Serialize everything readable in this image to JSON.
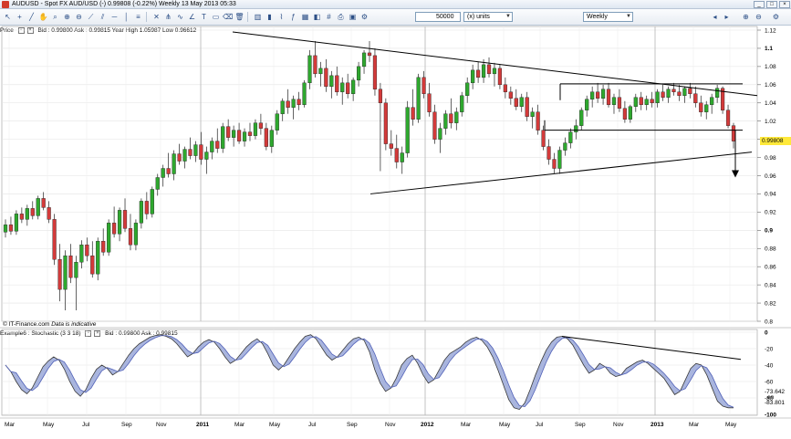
{
  "window": {
    "title": "AUDUSD - Spot FX AUD/USD (-)  0.99808 (-0.22%)   Weekly  13 May 2013 05:33"
  },
  "toolbar": {
    "quantity": "50000",
    "units": "(x) units",
    "period": "Weekly"
  },
  "price_panel": {
    "title": "Price",
    "info": "Bid : 0.99800 Ask : 0.99815  Year High 1.05987  Low 0.96612",
    "last_price": "0.99808",
    "footer_brand": "© IT-Finance.com",
    "footer_note": "Data is indicative"
  },
  "stoch_panel": {
    "title": "Example6 : Stochastic (3 3 18)",
    "info": "Bid : 0.99800 Ask : 0.99815",
    "value1": "-73.642",
    "value_sep": "en",
    "value2": "-83.801"
  },
  "colors": {
    "up": "#2ea82e",
    "down": "#d33a3a",
    "stoch_fill": "#9aa8d8",
    "stoch_line": "#3a3a3a"
  },
  "chart_data": {
    "type": "candlestick",
    "x_ticks": [
      "Mar",
      "May",
      "Jul",
      "Sep",
      "Nov",
      "2011",
      "Mar",
      "May",
      "Jul",
      "Sep",
      "Nov",
      "2012",
      "Mar",
      "May",
      "Jul",
      "Sep",
      "Nov",
      "2013",
      "Mar",
      "May"
    ],
    "price_y_ticks": [
      "1.12",
      "1.1",
      "1.08",
      "1.06",
      "1.04",
      "1.02",
      "1",
      "0.98",
      "0.96",
      "0.94",
      "0.92",
      "0.9",
      "0.88",
      "0.86",
      "0.84",
      "0.82",
      "0.8"
    ],
    "price_ylim": [
      0.8,
      1.12
    ],
    "stoch_y_ticks": [
      "0",
      "-20",
      "-40",
      "-60",
      "-80",
      "-100"
    ],
    "stoch_ylim": [
      -100,
      0
    ],
    "candles": [
      [
        0.898,
        0.912,
        0.892,
        0.906
      ],
      [
        0.906,
        0.915,
        0.895,
        0.899
      ],
      [
        0.899,
        0.922,
        0.895,
        0.918
      ],
      [
        0.918,
        0.925,
        0.908,
        0.912
      ],
      [
        0.912,
        0.928,
        0.905,
        0.924
      ],
      [
        0.924,
        0.932,
        0.912,
        0.916
      ],
      [
        0.916,
        0.938,
        0.912,
        0.935
      ],
      [
        0.935,
        0.942,
        0.922,
        0.925
      ],
      [
        0.925,
        0.932,
        0.908,
        0.912
      ],
      [
        0.912,
        0.918,
        0.862,
        0.868
      ],
      [
        0.868,
        0.885,
        0.822,
        0.835
      ],
      [
        0.835,
        0.878,
        0.812,
        0.872
      ],
      [
        0.872,
        0.885,
        0.842,
        0.848
      ],
      [
        0.848,
        0.872,
        0.812,
        0.865
      ],
      [
        0.865,
        0.889,
        0.858,
        0.884
      ],
      [
        0.884,
        0.892,
        0.866,
        0.872
      ],
      [
        0.872,
        0.888,
        0.848,
        0.852
      ],
      [
        0.852,
        0.892,
        0.845,
        0.888
      ],
      [
        0.888,
        0.902,
        0.872,
        0.876
      ],
      [
        0.876,
        0.912,
        0.872,
        0.908
      ],
      [
        0.908,
        0.926,
        0.892,
        0.896
      ],
      [
        0.896,
        0.925,
        0.888,
        0.922
      ],
      [
        0.922,
        0.935,
        0.898,
        0.902
      ],
      [
        0.902,
        0.918,
        0.878,
        0.884
      ],
      [
        0.884,
        0.912,
        0.878,
        0.908
      ],
      [
        0.908,
        0.935,
        0.902,
        0.932
      ],
      [
        0.932,
        0.942,
        0.912,
        0.918
      ],
      [
        0.918,
        0.948,
        0.914,
        0.945
      ],
      [
        0.945,
        0.962,
        0.938,
        0.958
      ],
      [
        0.958,
        0.972,
        0.948,
        0.968
      ],
      [
        0.968,
        0.985,
        0.958,
        0.962
      ],
      [
        0.962,
        0.988,
        0.955,
        0.984
      ],
      [
        0.984,
        0.995,
        0.972,
        0.976
      ],
      [
        0.976,
        0.992,
        0.968,
        0.989
      ],
      [
        0.989,
        1.002,
        0.978,
        0.982
      ],
      [
        0.982,
        0.998,
        0.975,
        0.994
      ],
      [
        0.994,
        1.008,
        0.972,
        0.978
      ],
      [
        0.978,
        0.992,
        0.962,
        0.986
      ],
      [
        0.986,
        1.002,
        0.978,
        0.998
      ],
      [
        0.998,
        1.012,
        0.985,
        0.99
      ],
      [
        0.99,
        1.018,
        0.985,
        1.014
      ],
      [
        1.014,
        1.022,
        0.998,
        1.002
      ],
      [
        1.002,
        1.015,
        0.992,
        1.01
      ],
      [
        1.01,
        1.018,
        0.995,
        0.998
      ],
      [
        0.998,
        1.012,
        0.992,
        1.008
      ],
      [
        1.008,
        1.018,
        0.998,
        1.004
      ],
      [
        1.004,
        1.022,
        1.0,
        1.018
      ],
      [
        1.018,
        1.028,
        1.005,
        1.012
      ],
      [
        1.012,
        1.018,
        0.988,
        0.992
      ],
      [
        0.992,
        1.015,
        0.985,
        1.01
      ],
      [
        1.01,
        1.032,
        1.005,
        1.028
      ],
      [
        1.028,
        1.045,
        1.02,
        1.042
      ],
      [
        1.042,
        1.055,
        1.028,
        1.035
      ],
      [
        1.035,
        1.048,
        1.022,
        1.044
      ],
      [
        1.044,
        1.052,
        1.032,
        1.038
      ],
      [
        1.038,
        1.065,
        1.035,
        1.062
      ],
      [
        1.062,
        1.098,
        1.055,
        1.092
      ],
      [
        1.092,
        1.108,
        1.068,
        1.072
      ],
      [
        1.072,
        1.085,
        1.058,
        1.078
      ],
      [
        1.078,
        1.088,
        1.052,
        1.058
      ],
      [
        1.058,
        1.075,
        1.045,
        1.07
      ],
      [
        1.07,
        1.08,
        1.048,
        1.052
      ],
      [
        1.052,
        1.068,
        1.038,
        1.062
      ],
      [
        1.062,
        1.072,
        1.045,
        1.05
      ],
      [
        1.05,
        1.068,
        1.042,
        1.065
      ],
      [
        1.065,
        1.085,
        1.058,
        1.08
      ],
      [
        1.08,
        1.098,
        1.072,
        1.095
      ],
      [
        1.095,
        1.108,
        1.085,
        1.092
      ],
      [
        1.092,
        1.1,
        1.048,
        1.055
      ],
      [
        1.055,
        1.062,
        0.965,
        1.04
      ],
      [
        1.04,
        1.045,
        0.988,
        0.995
      ],
      [
        0.995,
        1.01,
        0.982,
        0.99
      ],
      [
        0.99,
        1.005,
        0.968,
        0.975
      ],
      [
        0.975,
        0.992,
        0.962,
        0.985
      ],
      [
        0.985,
        1.042,
        0.98,
        1.035
      ],
      [
        1.035,
        1.055,
        1.015,
        1.022
      ],
      [
        1.022,
        1.072,
        1.018,
        1.068
      ],
      [
        1.068,
        1.075,
        1.045,
        1.05
      ],
      [
        1.05,
        1.062,
        1.025,
        1.03
      ],
      [
        1.03,
        1.038,
        0.995,
        1.0
      ],
      [
        1.0,
        1.018,
        0.985,
        1.012
      ],
      [
        1.012,
        1.032,
        1.005,
        1.028
      ],
      [
        1.028,
        1.045,
        1.012,
        1.018
      ],
      [
        1.018,
        1.035,
        1.01,
        1.03
      ],
      [
        1.03,
        1.052,
        1.025,
        1.048
      ],
      [
        1.048,
        1.068,
        1.04,
        1.062
      ],
      [
        1.062,
        1.082,
        1.055,
        1.076
      ],
      [
        1.076,
        1.085,
        1.062,
        1.068
      ],
      [
        1.068,
        1.088,
        1.062,
        1.082
      ],
      [
        1.082,
        1.09,
        1.068,
        1.072
      ],
      [
        1.072,
        1.084,
        1.058,
        1.078
      ],
      [
        1.078,
        1.082,
        1.055,
        1.06
      ],
      [
        1.06,
        1.068,
        1.045,
        1.052
      ],
      [
        1.052,
        1.058,
        1.038,
        1.045
      ],
      [
        1.045,
        1.055,
        1.032,
        1.036
      ],
      [
        1.036,
        1.05,
        1.03,
        1.046
      ],
      [
        1.046,
        1.052,
        1.02,
        1.025
      ],
      [
        1.025,
        1.035,
        1.012,
        1.03
      ],
      [
        1.03,
        1.038,
        1.005,
        1.01
      ],
      [
        1.01,
        1.015,
        0.988,
        0.992
      ],
      [
        0.992,
        1.0,
        0.972,
        0.978
      ],
      [
        0.978,
        0.985,
        0.962,
        0.968
      ],
      [
        0.968,
        0.992,
        0.962,
        0.988
      ],
      [
        0.988,
        1.002,
        0.982,
        0.996
      ],
      [
        0.996,
        1.012,
        0.99,
        1.008
      ],
      [
        1.008,
        1.022,
        1.0,
        1.015
      ],
      [
        1.015,
        1.035,
        1.01,
        1.032
      ],
      [
        1.032,
        1.048,
        1.025,
        1.044
      ],
      [
        1.044,
        1.058,
        1.035,
        1.052
      ],
      [
        1.052,
        1.062,
        1.04,
        1.045
      ],
      [
        1.045,
        1.06,
        1.038,
        1.055
      ],
      [
        1.055,
        1.062,
        1.035,
        1.038
      ],
      [
        1.038,
        1.05,
        1.028,
        1.046
      ],
      [
        1.046,
        1.055,
        1.03,
        1.034
      ],
      [
        1.034,
        1.042,
        1.018,
        1.022
      ],
      [
        1.022,
        1.038,
        1.018,
        1.036
      ],
      [
        1.036,
        1.05,
        1.03,
        1.046
      ],
      [
        1.046,
        1.052,
        1.032,
        1.038
      ],
      [
        1.038,
        1.048,
        1.032,
        1.044
      ],
      [
        1.044,
        1.052,
        1.035,
        1.04
      ],
      [
        1.04,
        1.055,
        1.035,
        1.052
      ],
      [
        1.052,
        1.06,
        1.042,
        1.046
      ],
      [
        1.046,
        1.058,
        1.04,
        1.055
      ],
      [
        1.055,
        1.062,
        1.048,
        1.052
      ],
      [
        1.052,
        1.06,
        1.042,
        1.048
      ],
      [
        1.048,
        1.058,
        1.04,
        1.056
      ],
      [
        1.056,
        1.062,
        1.045,
        1.05
      ],
      [
        1.05,
        1.058,
        1.035,
        1.04
      ],
      [
        1.04,
        1.048,
        1.025,
        1.03
      ],
      [
        1.03,
        1.042,
        1.022,
        1.038
      ],
      [
        1.038,
        1.05,
        1.028,
        1.046
      ],
      [
        1.046,
        1.06,
        1.04,
        1.056
      ],
      [
        1.056,
        1.058,
        1.028,
        1.032
      ],
      [
        1.032,
        1.038,
        1.012,
        1.015
      ],
      [
        1.015,
        1.018,
        0.99,
        0.998
      ]
    ],
    "stochastic": [
      -40,
      -48,
      -60,
      -70,
      -75,
      -68,
      -55,
      -42,
      -35,
      -30,
      -34,
      -45,
      -60,
      -72,
      -78,
      -70,
      -56,
      -45,
      -40,
      -44,
      -52,
      -48,
      -38,
      -28,
      -20,
      -14,
      -10,
      -6,
      -4,
      -3,
      -5,
      -8,
      -14,
      -22,
      -30,
      -26,
      -18,
      -12,
      -9,
      -12,
      -20,
      -30,
      -38,
      -34,
      -26,
      -18,
      -12,
      -8,
      -14,
      -26,
      -40,
      -46,
      -40,
      -30,
      -20,
      -12,
      -5,
      -3,
      -8,
      -18,
      -28,
      -34,
      -30,
      -22,
      -14,
      -8,
      -6,
      -10,
      -24,
      -46,
      -62,
      -72,
      -68,
      -56,
      -40,
      -32,
      -28,
      -38,
      -52,
      -62,
      -58,
      -46,
      -34,
      -26,
      -22,
      -18,
      -12,
      -8,
      -6,
      -10,
      -18,
      -30,
      -46,
      -64,
      -82,
      -92,
      -94,
      -86,
      -70,
      -52,
      -36,
      -22,
      -12,
      -6,
      -5,
      -8,
      -16,
      -28,
      -40,
      -50,
      -46,
      -38,
      -42,
      -50,
      -54,
      -52,
      -44,
      -40,
      -36,
      -34,
      -38,
      -44,
      -50,
      -56,
      -66,
      -76,
      -72,
      -58,
      -44,
      -38,
      -40,
      -52,
      -68,
      -84,
      -90,
      -92,
      -92
    ]
  }
}
